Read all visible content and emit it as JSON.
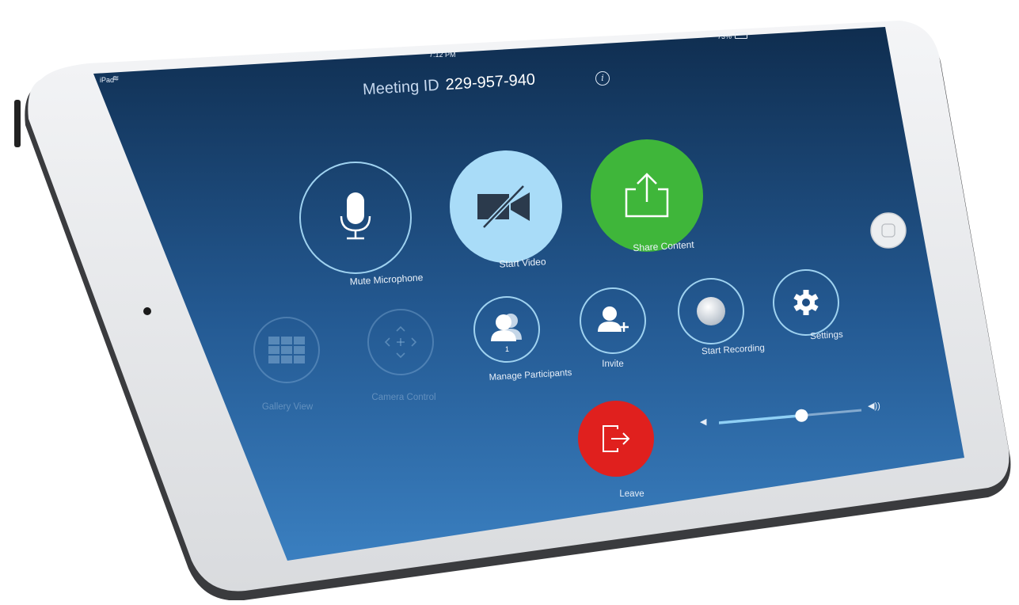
{
  "status_bar": {
    "carrier": "iPad",
    "time": "7:12 PM",
    "battery": "73%"
  },
  "meeting": {
    "id_label": "Meeting ID",
    "id_value": "229-957-940"
  },
  "primary_controls": [
    {
      "label": "Mute Microphone",
      "icon": "microphone-icon"
    },
    {
      "label": "Start Video",
      "icon": "video-off-icon"
    },
    {
      "label": "Share Content",
      "icon": "share-icon"
    }
  ],
  "secondary_controls": [
    {
      "label": "Gallery View",
      "icon": "grid-icon",
      "enabled": false
    },
    {
      "label": "Camera Control",
      "icon": "camera-control-icon",
      "enabled": false
    },
    {
      "label": "Manage Participants",
      "icon": "participants-icon",
      "enabled": true,
      "badge": "1"
    },
    {
      "label": "Invite",
      "icon": "add-user-icon",
      "enabled": true
    },
    {
      "label": "Start Recording",
      "icon": "record-icon",
      "enabled": true
    },
    {
      "label": "Settings",
      "icon": "gear-icon",
      "enabled": true
    }
  ],
  "leave": {
    "label": "Leave",
    "icon": "leave-icon"
  },
  "volume": {
    "level": 0.58,
    "min_icon": "speaker-low-icon",
    "max_icon": "speaker-high-icon"
  },
  "colors": {
    "screen_top": "#0f2d4f",
    "screen_bottom": "#3a7fc0",
    "video_button": "#a9dcf8",
    "share_button": "#3fb63a",
    "leave_button": "#e0201e",
    "accent_ring": "#9fd2f0"
  }
}
